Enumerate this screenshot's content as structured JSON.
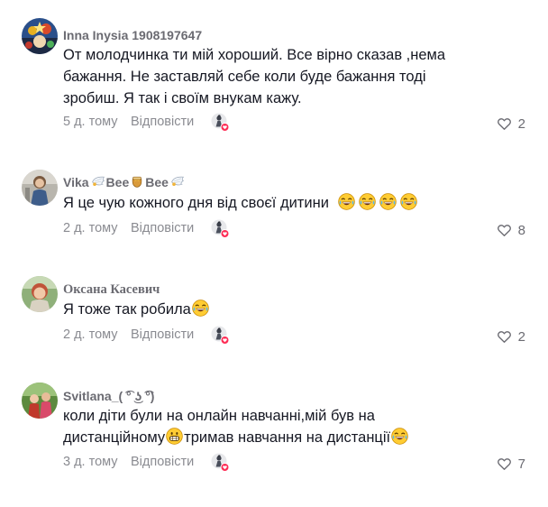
{
  "comments": [
    {
      "username": "Inna Inysia 1908197647",
      "lines": [
        "От молодчинка ти мій хороший. Все вірно сказав ,нема",
        "бажання. Не заставляй себе коли буде бажання тоді",
        "зробиш. Я так і своїм внукам кажу."
      ],
      "time": "5 д. тому",
      "reply_label": "Відповісти",
      "likes": "2"
    },
    {
      "username_parts": [
        "Vika",
        "Bee",
        "Bee"
      ],
      "text": "Я це чую кожного дня від своєї дитини",
      "emoji": [
        "laugh-cry",
        "laugh-cry",
        "laugh-cry",
        "laugh-cry"
      ],
      "time": "2 д. тому",
      "reply_label": "Відповісти",
      "likes": "8"
    },
    {
      "username": "Оксана Касевич",
      "text": "Я тоже так робила",
      "emoji": [
        "laugh-cry"
      ],
      "time": "2 д. тому",
      "reply_label": "Відповісти",
      "likes": "2"
    },
    {
      "username": "Svitlana_( ͡° ͜ʖ ͡°)",
      "line1": "коли діти були на онлайн навчанні,мій був на",
      "line2_a": "дистанційному",
      "line2_b": "тримав навчання на дистанції",
      "time": "3 д. тому",
      "reply_label": "Відповісти",
      "likes": "7"
    }
  ],
  "icons": {
    "like": "heart-outline-icon",
    "creator_liked": "creator-liked-icon",
    "emoji_laugh": "laugh-cry-emoji",
    "emoji_big_grin": "grin-emoji",
    "emoji_wings": "wing-emoji",
    "emoji_honey": "honey-pot-emoji"
  },
  "colors": {
    "text": "#161823",
    "muted": "#8a8b91",
    "username": "#6b6b72",
    "like_dot": "#fe2c55"
  }
}
